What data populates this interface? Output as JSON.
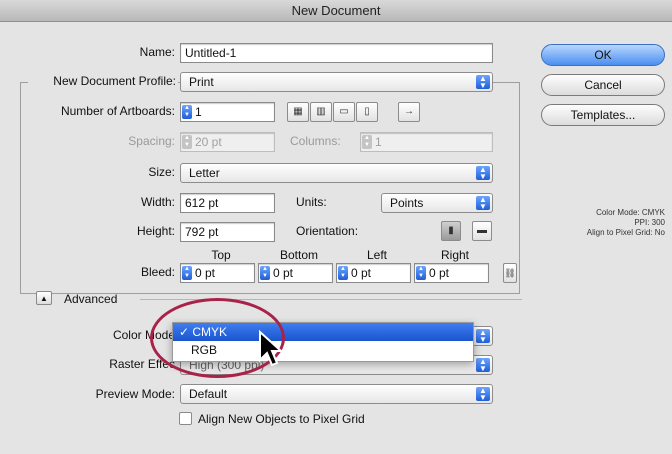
{
  "window": {
    "title": "New Document"
  },
  "form": {
    "name_label": "Name:",
    "name_value": "Untitled-1",
    "profile_label": "New Document Profile:",
    "profile_value": "Print",
    "artboards_label": "Number of Artboards:",
    "artboards_value": "1",
    "spacing_label": "Spacing:",
    "spacing_value": "20 pt",
    "columns_label": "Columns:",
    "columns_value": "1",
    "size_label": "Size:",
    "size_value": "Letter",
    "width_label": "Width:",
    "width_value": "612 pt",
    "units_label": "Units:",
    "units_value": "Points",
    "height_label": "Height:",
    "height_value": "792 pt",
    "orientation_label": "Orientation:",
    "bleed_label": "Bleed:",
    "bleed_headers": {
      "top": "Top",
      "bottom": "Bottom",
      "left": "Left",
      "right": "Right"
    },
    "bleed_values": {
      "top": "0 pt",
      "bottom": "0 pt",
      "left": "0 pt",
      "right": "0 pt"
    }
  },
  "advanced": {
    "label": "Advanced",
    "color_mode_label": "Color Mode:",
    "color_mode_label_visible": "Color Mode",
    "color_mode_options": [
      "CMYK",
      "RGB"
    ],
    "color_mode_selected": "CMYK",
    "raster_label": "Raster Effects:",
    "raster_label_visible": "Raster Effec",
    "raster_value_visible": "High (300 ppi)",
    "preview_label": "Preview Mode:",
    "preview_value": "Default",
    "align_checkbox_label": "Align New Objects to Pixel Grid"
  },
  "buttons": {
    "ok": "OK",
    "cancel": "Cancel",
    "templates": "Templates..."
  },
  "info": {
    "line1": "Color Mode: CMYK",
    "line2": "PPI: 300",
    "line3": "Align to Pixel Grid: No"
  },
  "colors": {
    "accent": "#2a6be0",
    "highlight_ring": "#a8234a"
  }
}
